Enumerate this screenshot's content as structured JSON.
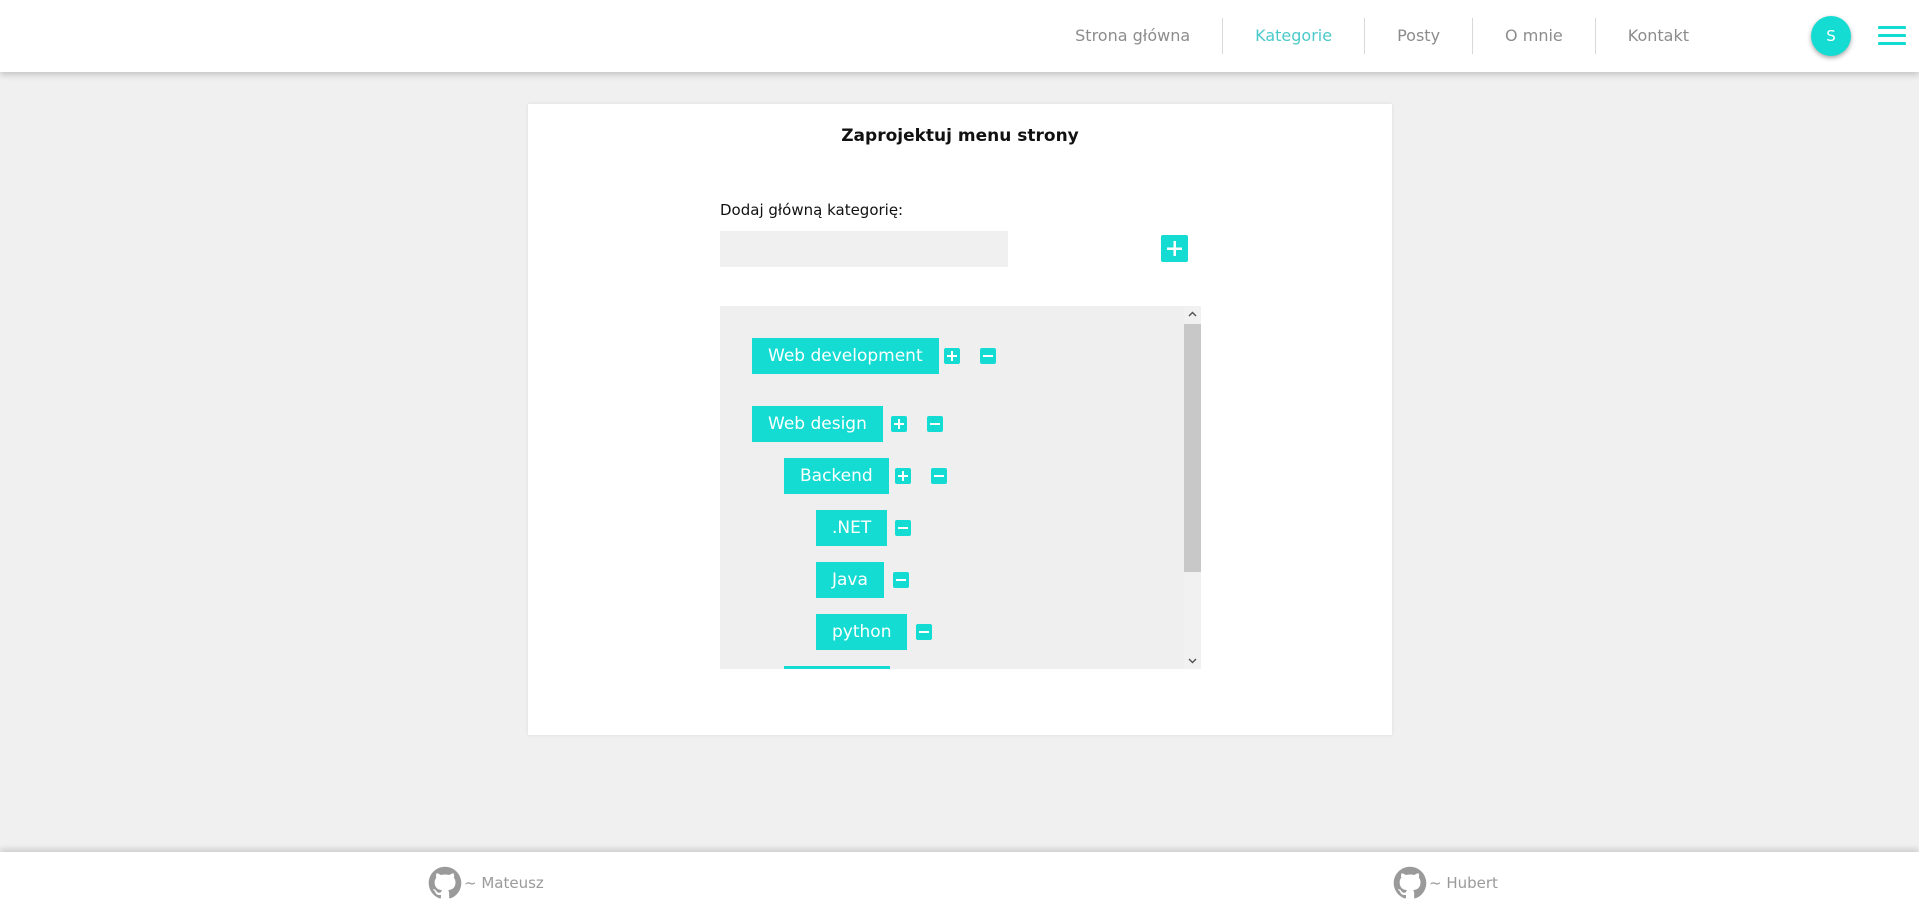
{
  "nav": {
    "items": [
      {
        "label": "Strona główna"
      },
      {
        "label": "Kategorie"
      },
      {
        "label": "Posty"
      },
      {
        "label": "O mnie"
      },
      {
        "label": "Kontakt"
      }
    ],
    "active": "Kategorie",
    "avatar_letter": "S"
  },
  "editor": {
    "title": "Zaprojektuj menu strony",
    "main_category_label": "Dodaj główną kategorię:",
    "main_category_value": "",
    "categories": [
      {
        "label": "Web development",
        "level": 0
      },
      {
        "label": "Web design",
        "level": 0
      },
      {
        "label": "Backend",
        "level": 1
      },
      {
        "label": ".NET",
        "level": 2
      },
      {
        "label": "Java",
        "level": 2
      },
      {
        "label": "python",
        "level": 2
      }
    ]
  },
  "footer": {
    "authors": [
      {
        "label": "~ Mateusz",
        "icon": "github-icon"
      },
      {
        "label": "~ Hubert",
        "icon": "github-icon"
      }
    ]
  },
  "colors": {
    "accent": "#14dcd2",
    "nav_active": "#4cc9c9",
    "nav_inactive": "#8c8c8c",
    "background": "#f0f0f0"
  }
}
